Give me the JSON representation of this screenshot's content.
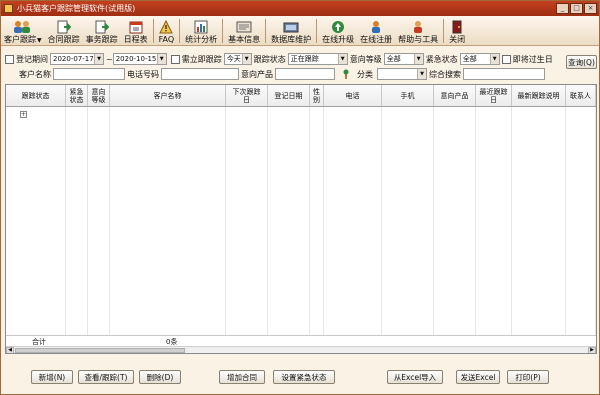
{
  "window": {
    "title": "小兵猫客户跟踪管理软件(试用版)",
    "controls": {
      "minimize": "_",
      "maximize": "□",
      "close": "×"
    }
  },
  "toolbar": {
    "items": [
      {
        "label": "客户跟踪",
        "icon": "people-icon",
        "dropdown": "▼"
      },
      {
        "label": "合同跟踪",
        "icon": "contract-arrow-icon"
      },
      {
        "label": "事务跟踪",
        "icon": "task-arrow-icon"
      },
      {
        "label": "日程表",
        "icon": "calendar-icon"
      },
      {
        "label": "FAQ",
        "icon": "faq-icon"
      },
      {
        "label": "统计分析",
        "icon": "chart-icon"
      },
      {
        "label": "基本信息",
        "icon": "info-icon"
      },
      {
        "label": "数据库维护",
        "icon": "database-icon"
      },
      {
        "label": "在线升级",
        "icon": "upgrade-icon"
      },
      {
        "label": "在线注册",
        "icon": "register-icon"
      },
      {
        "label": "帮助与工具",
        "icon": "help-icon"
      },
      {
        "label": "关闭",
        "icon": "close-door-icon"
      }
    ]
  },
  "filters": {
    "date_range_label": "登记期间",
    "date_from": "2020-07-17",
    "date_to": "2020-10-15",
    "tilde": "~",
    "immediate_label": "需立即跟踪",
    "immediate_value": "今天",
    "status_label": "跟踪状态",
    "status_value": "正在跟踪",
    "intent_label": "意向等级",
    "intent_value": "全部",
    "urgent_label": "紧急状态",
    "urgent_value": "全部",
    "birthday_label": "即将过生日",
    "query_button": "查询(Q)",
    "customer_name_label": "客户名称",
    "phone_label": "电话号码",
    "product_label": "意向产品",
    "category_label": "分类",
    "search_label": "综合搜索"
  },
  "grid": {
    "columns": [
      "跟踪状态",
      "紧急\n状态",
      "意向\n等级",
      "客户名称",
      "下次跟踪\n日",
      "登记日期",
      "性\n别",
      "电话",
      "手机",
      "意向产品",
      "最近跟踪\n日",
      "最新跟踪说明",
      "联系人"
    ],
    "expander": "+",
    "footer": {
      "total_label": "合计",
      "count": "0条"
    },
    "scroll_left": "◀",
    "scroll_right": "▶"
  },
  "actions": {
    "add": "新增(N)",
    "view": "查看/跟踪(T)",
    "delete": "删除(D)",
    "add_contract": "增加合同",
    "set_urgent": "设置紧急状态",
    "import_excel": "从Excel导入",
    "send_excel": "发送Excel",
    "print": "打印(P)"
  },
  "colors": {
    "titlebar": "#b2381a",
    "window_bg": "#fbf2e6",
    "toolbar_bg": "#f3e6d2"
  }
}
